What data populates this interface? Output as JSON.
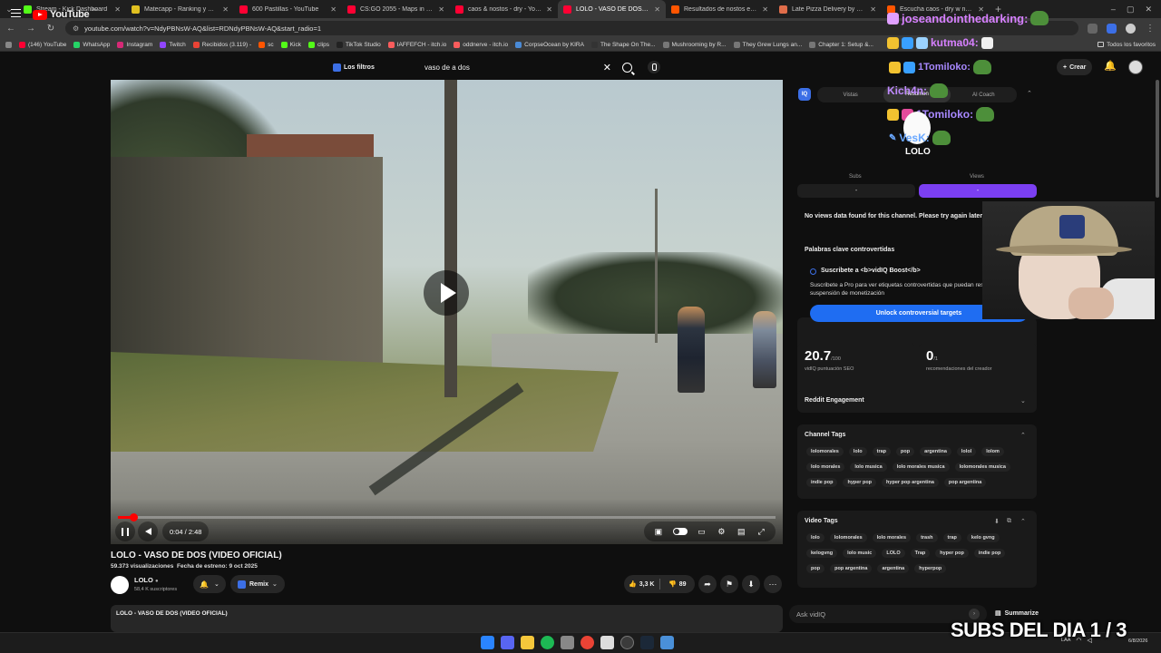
{
  "browser": {
    "tabs": [
      {
        "label": "Stream - Kick Dashboard",
        "color": "#53fc18"
      },
      {
        "label": "Matecapp - Ranking y Racha d",
        "color": "#e0c020"
      },
      {
        "label": "600 Pastillas - YouTube",
        "color": "#ff0033"
      },
      {
        "label": "CS:GO 2055 - Maps in the Futu",
        "color": "#ff0033"
      },
      {
        "label": "caos & nostos - dry - YouTube",
        "color": "#ff0033"
      },
      {
        "label": "LOLO - VASO DE DOS (VID",
        "color": "#ff0033",
        "active": true
      },
      {
        "label": "Resultados de nostos en Sound",
        "color": "#ff5500"
      },
      {
        "label": "Late Pizza Delivery by BubuWo",
        "color": "#e06d4a"
      },
      {
        "label": "Escucha caos - dry w nostos de",
        "color": "#ff5500"
      }
    ],
    "url": "youtube.com/watch?v=NdyPBNsW-AQ&list=RDNdyPBNsW-AQ&start_radio=1",
    "bookmarks": [
      {
        "label": "(146) YouTube",
        "color": "#ff0033"
      },
      {
        "label": "WhatsApp",
        "color": "#25d366"
      },
      {
        "label": "Instagram",
        "color": "#d62976"
      },
      {
        "label": "Twitch",
        "color": "#9146ff"
      },
      {
        "label": "Recibidos (3.119) -",
        "color": "#ea4335"
      },
      {
        "label": "sc",
        "color": "#ff5500"
      },
      {
        "label": "Kick",
        "color": "#53fc18"
      },
      {
        "label": "clips",
        "color": "#53fc18"
      },
      {
        "label": "TikTok Studio",
        "color": "#222222"
      },
      {
        "label": "IAFFEFCH - itch.io",
        "color": "#fa5c5c"
      },
      {
        "label": "oddnerve - itch.io",
        "color": "#fa5c5c"
      },
      {
        "label": "CorpseOcean by KIRA",
        "color": "#4a8ad6"
      },
      {
        "label": "The Shape On The...",
        "color": "#333333"
      },
      {
        "label": "Mushrooming by R...",
        "color": "#777777"
      },
      {
        "label": "They Grew Lungs an...",
        "color": "#777777"
      },
      {
        "label": "Chapter 1: Setup &...",
        "color": "#777777"
      }
    ],
    "bookmarks_all": "Todos los favoritos"
  },
  "youtube": {
    "logo": "YouTube",
    "country": "AR",
    "filters": "Los filtros",
    "search_value": "vaso de a dos",
    "create": "Crear"
  },
  "player": {
    "time": "0:04 / 2:48",
    "progress": 0.024
  },
  "video": {
    "title": "LOLO - VASO DE DOS (VIDEO OFICIAL)",
    "views": "59.373 visualizaciones",
    "date": "Fecha de estreno: 9 oct 2025",
    "channel": "LOLO",
    "subscribers": "58,4 K suscriptores",
    "remix": "Remix",
    "likes": "3,3 K",
    "dislikes": "89",
    "desc_title": "LOLO - VASO DE DOS (VIDEO OFICIAL)"
  },
  "vidiq": {
    "logo": "IQ",
    "tabs": [
      "Vistas",
      "Resumen",
      "AI Coach"
    ],
    "subs_label": "Subs",
    "views_label": "Views",
    "subs_value": "-",
    "views_value": "-",
    "no_data": "No views data found for this channel. Please try again later.",
    "controversial_title": "Palabras clave controvertidas",
    "boost_title": "Suscribete a <b>vidIQ Boost</b>",
    "boost_desc": "Suscribete a Pro para ver etiquetas controvertidas que puedan resultar en la suspensión de monetización",
    "unlock": "Unlock controversial targets",
    "seo_score": "20.7",
    "seo_max": "/100",
    "seo_label": "vidIQ puntuación SEO",
    "creator_recs": "0",
    "creator_recs_max": "/1",
    "creator_label": "recomendaciones del creador",
    "reddit": "Reddit Engagement",
    "channel_tags_title": "Channel Tags",
    "channel_tags": [
      [
        "lolomorales",
        "lolo",
        "trap",
        "pop",
        "argentina",
        "lolol",
        "lolom"
      ],
      [
        "lolo morales",
        "lolo musica",
        "lolo morales musica",
        "lolomorales musica"
      ],
      [
        "indie pop",
        "hyper pop",
        "hyper pop argentina",
        "pop argentina"
      ]
    ],
    "video_tags_title": "Video Tags",
    "video_tags": [
      [
        "lolo",
        "lolomorales",
        "lolo morales",
        "trash",
        "trap",
        "kelo gvng"
      ],
      [
        "kelogvng",
        "lolo music",
        "LOLO",
        "Trap",
        "hyper pop",
        "indie pop"
      ],
      [
        "pop",
        "pop argentina",
        "argentina",
        "hyperpop"
      ]
    ],
    "ask": "Ask vidIQ",
    "summarize": "Summarize"
  },
  "chat": {
    "line1": "joseandointhedarking:",
    "line2": "kutma04:",
    "line3": "1Tomiloko:",
    "line4": "Kich4n:",
    "line5": "1Tomiloko:",
    "line6": "VesK:",
    "lolo_label": "LOLO"
  },
  "overlay": {
    "subs": "SUBS DEL DIA 1 / 3"
  },
  "taskbar": {
    "lang": "LAA",
    "date": "6/8/2026"
  }
}
